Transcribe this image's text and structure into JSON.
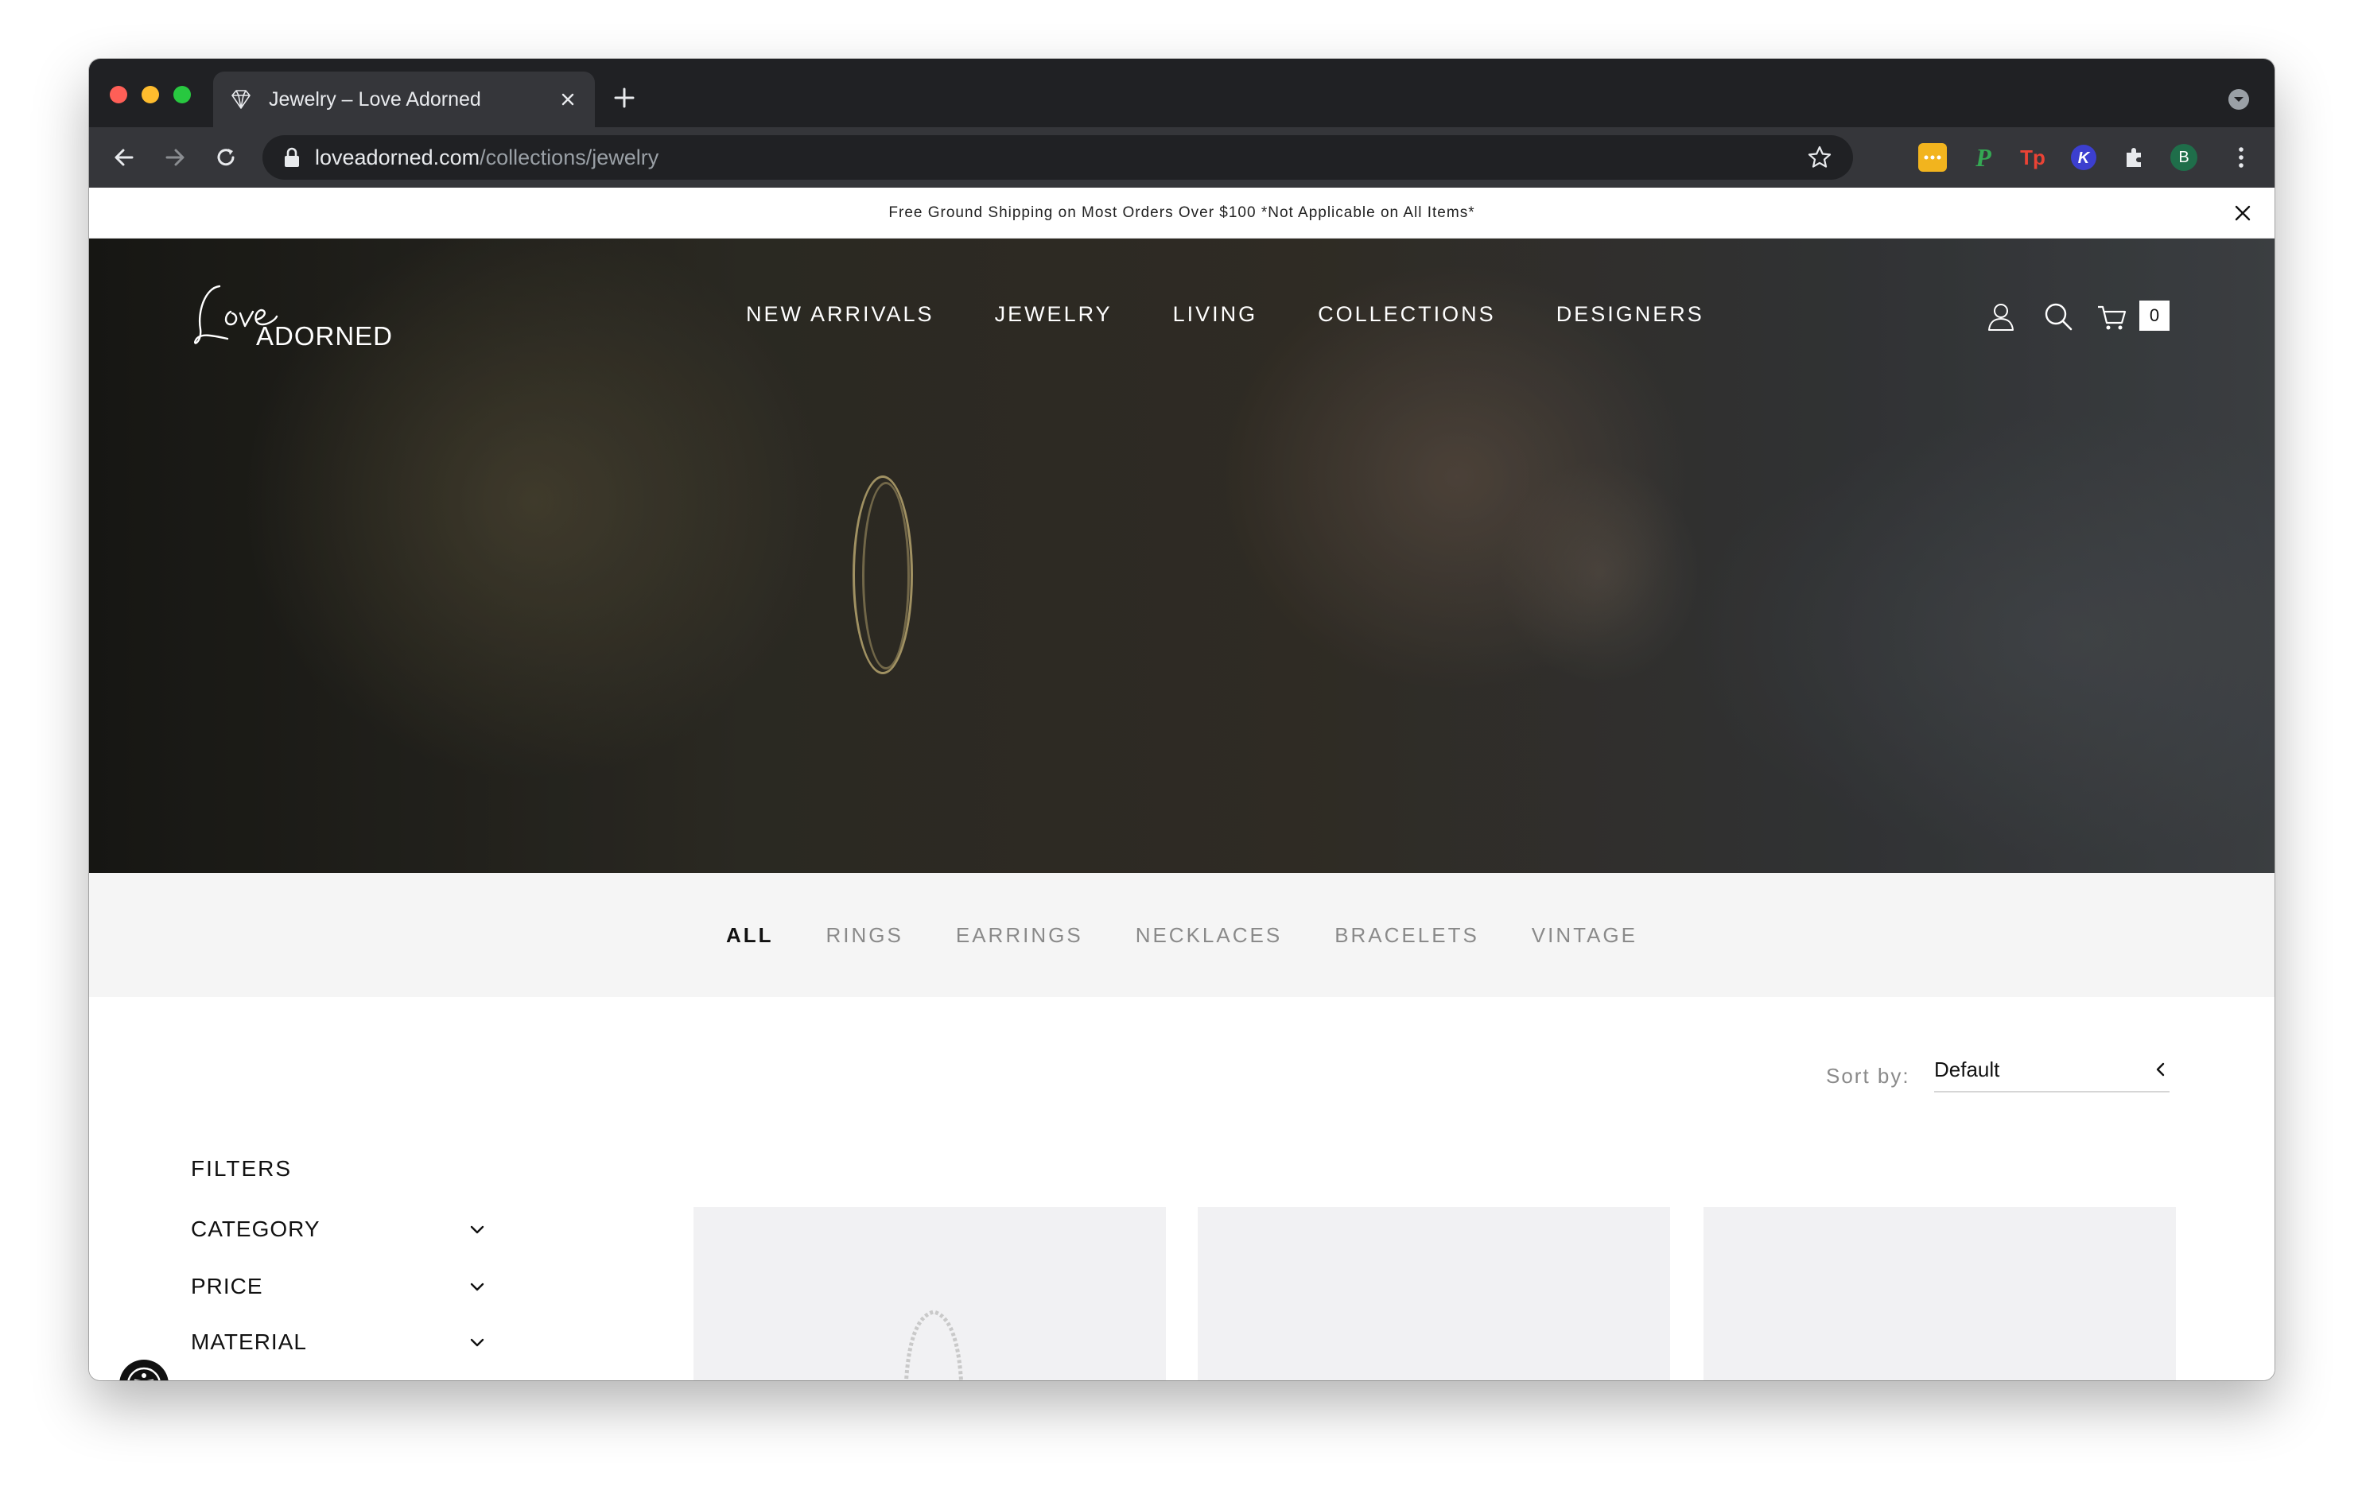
{
  "browser": {
    "tab_title": "Jewelry – Love Adorned",
    "url_host": "loveadorned.com",
    "url_path": "/collections/jewelry",
    "profile_initial": "B"
  },
  "site": {
    "announcement": "Free Ground Shipping on Most Orders Over $100 *Not Applicable on All Items*",
    "logo_text": "ADORNED",
    "nav": [
      "NEW ARRIVALS",
      "JEWELRY",
      "LIVING",
      "COLLECTIONS",
      "DESIGNERS"
    ],
    "cart_count": "0"
  },
  "categories": {
    "items": [
      "ALL",
      "RINGS",
      "EARRINGS",
      "NECKLACES",
      "BRACELETS",
      "VINTAGE"
    ],
    "active": "ALL"
  },
  "sort": {
    "label": "Sort by:",
    "value": "Default"
  },
  "filters": {
    "title": "FILTERS",
    "items": [
      "CATEGORY",
      "PRICE",
      "MATERIAL"
    ]
  },
  "colors": {
    "chrome_dark": "#202124",
    "chrome_toolbar": "#35363a",
    "subnav_bg": "#f5f5f5",
    "product_bg": "#f1f1f3"
  }
}
